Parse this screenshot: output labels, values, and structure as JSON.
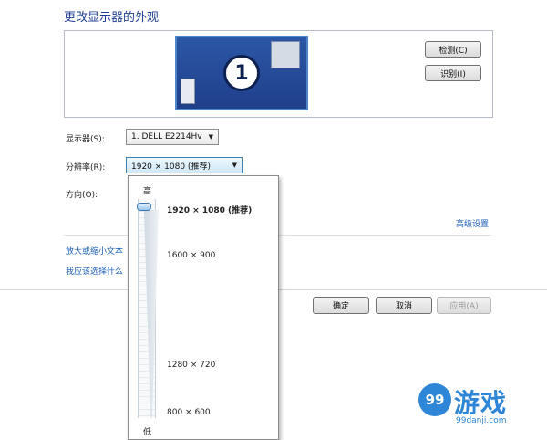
{
  "page": {
    "title": "更改显示器的外观"
  },
  "preview": {
    "monitor_number": "1",
    "detect_label": "检测(C)",
    "identify_label": "识别(I)"
  },
  "settings": {
    "display_label": "显示器(S):",
    "display_value": "1. DELL E2214Hv",
    "resolution_label": "分辨率(R):",
    "resolution_value": "1920 × 1080 (推荐)",
    "orientation_label": "方向(O):"
  },
  "resolution_popup": {
    "high_label": "高",
    "low_label": "低",
    "options": [
      "1920 × 1080 (推荐)",
      "1600 × 900",
      "1280 × 720",
      "800 × 600"
    ],
    "selected_index": 0
  },
  "links": {
    "advanced": "高级设置",
    "text_size": "放大或缩小文本",
    "which_settings": "我应该选择什么"
  },
  "footer": {
    "ok_label": "确定",
    "cancel_label": "取消",
    "apply_label": "应用(A)"
  },
  "watermark": {
    "logo": "99",
    "name": "游戏",
    "url": "99danji.com"
  },
  "colors": {
    "title": "#1e3e94",
    "link": "#1b5fb8",
    "monitor_fill": "#2b57a6",
    "watermark": "#2e86d6"
  }
}
